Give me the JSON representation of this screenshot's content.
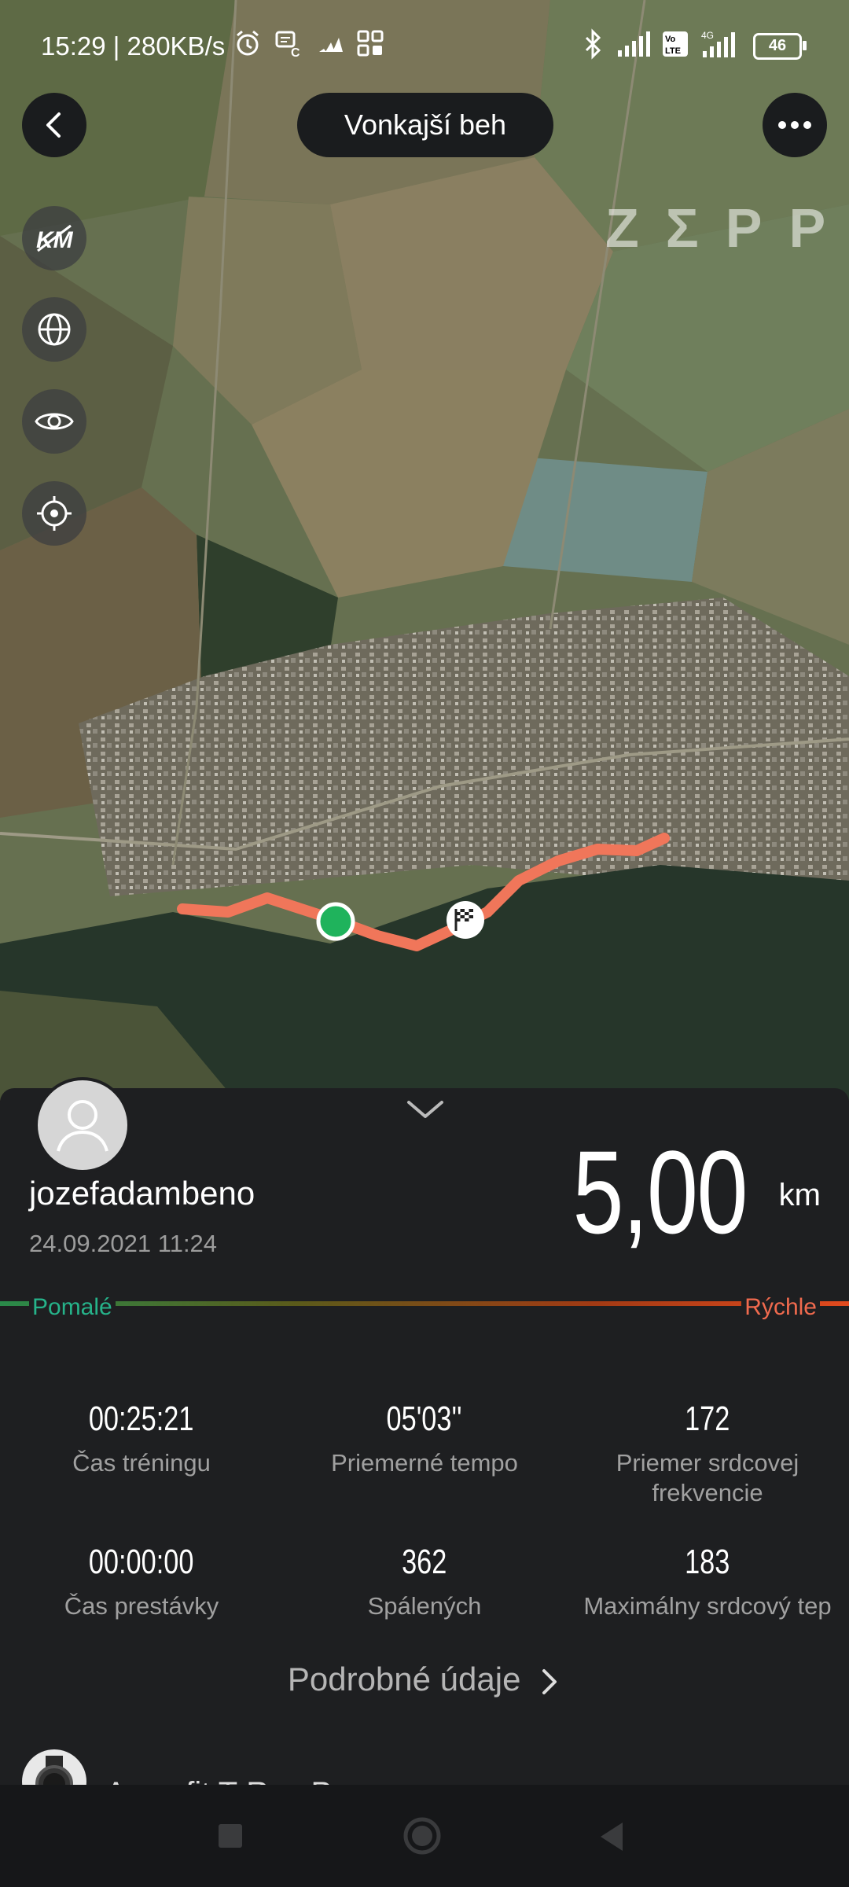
{
  "status_bar": {
    "time_speed": "15:29 | 280KB/s",
    "battery": "46",
    "icons": [
      "alarm-icon",
      "notification-icon",
      "adidas-icon",
      "app-icon",
      "bluetooth-icon",
      "signal-icon",
      "volte-icon",
      "signal-4g-icon",
      "battery-icon"
    ]
  },
  "header": {
    "title": "Vonkajší beh",
    "back_icon": "back-icon",
    "more_icon": "more-icon"
  },
  "map": {
    "logo": "ZΣPP",
    "side_buttons": [
      "km-marker-icon",
      "globe-icon",
      "eye-icon",
      "locate-icon"
    ],
    "route_color": "#f0765a",
    "start_color": "#1fb35c"
  },
  "workout": {
    "username": "jozefadambeno",
    "date": "24.09.2021 11:24",
    "distance": "5,00",
    "unit": "km",
    "slow_label": "Pomalé",
    "fast_label": "Rýchle",
    "stats": [
      {
        "value": "00:25:21",
        "label": "Čas tréningu"
      },
      {
        "value": "05'03''",
        "label": "Priemerné tempo"
      },
      {
        "value": "172",
        "label": "Priemer srdcovej frekvencie"
      },
      {
        "value": "00:00:00",
        "label": "Čas prestávky"
      },
      {
        "value": "362",
        "label": "Spálených"
      },
      {
        "value": "183",
        "label": "Maximálny srdcový tep"
      }
    ],
    "details_link": "Podrobné údaje",
    "device_name": "Amazfit T-Rex Pro"
  },
  "colors": {
    "sheet_bg": "#1e1f21",
    "slow": "#26b38a",
    "fast": "#f06a4e"
  }
}
